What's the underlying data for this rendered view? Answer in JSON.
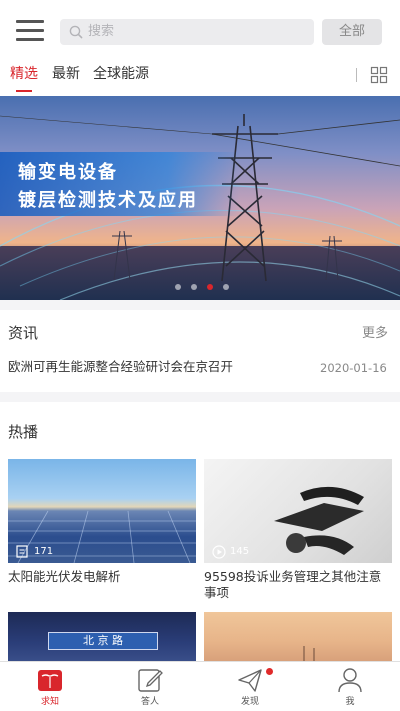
{
  "header": {
    "search_placeholder": "搜索",
    "all_button": "全部"
  },
  "tabs": [
    {
      "label": "精选",
      "active": true
    },
    {
      "label": "最新",
      "active": false
    },
    {
      "label": "全球能源",
      "active": false
    }
  ],
  "banner": {
    "line1": "输变电设备",
    "line2": "镀层检测技术及应用",
    "slide_count": 4,
    "active_slide_index": 2
  },
  "news": {
    "title": "资讯",
    "more": "更多",
    "items": [
      {
        "text": "欧洲可再生能源整合经验研讨会在京召开",
        "date": "2020-01-16"
      }
    ]
  },
  "hot": {
    "title": "热播",
    "cards": [
      {
        "title": "太阳能光伏发电解析",
        "meta": "171",
        "meta_icon": "document-icon"
      },
      {
        "title": "95598投诉业务管理之其他注意事项",
        "meta": "145",
        "meta_icon": "play-icon"
      },
      {
        "title": "",
        "meta": "",
        "thumb_text": "北 京 路"
      },
      {
        "title": "",
        "meta": ""
      }
    ]
  },
  "tabbar": [
    {
      "label": "求知",
      "icon": "book-icon",
      "active": true
    },
    {
      "label": "答人",
      "icon": "edit-icon",
      "active": false
    },
    {
      "label": "发现",
      "icon": "paper-plane-icon",
      "active": false,
      "badge": true
    },
    {
      "label": "我",
      "icon": "user-icon",
      "active": false
    }
  ],
  "colors": {
    "accent": "#d9262c",
    "background": "#f4f4f6"
  }
}
